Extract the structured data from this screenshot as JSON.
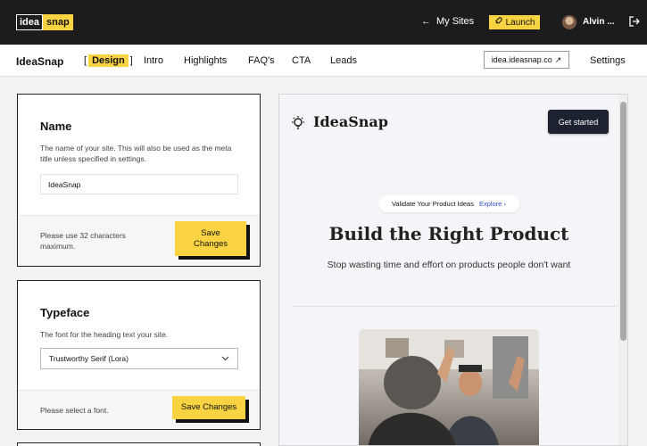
{
  "topbar": {
    "logo_part1": "idea",
    "logo_part2": "snap",
    "my_sites": "My Sites",
    "launch": "Launch",
    "user_name": "Alvin ..."
  },
  "subnav": {
    "brand": "IdeaSnap",
    "tabs": [
      {
        "label": "Design",
        "active": true
      },
      {
        "label": "Intro"
      },
      {
        "label": "Highlights"
      },
      {
        "label": "FAQ's"
      },
      {
        "label": "CTA"
      },
      {
        "label": "Leads"
      }
    ],
    "domain": "idea.ideasnap.co",
    "settings": "Settings"
  },
  "name_card": {
    "title": "Name",
    "description": "The name of your site. This will also be used as the meta title unless specified in settings.",
    "value": "IdeaSnap",
    "hint": "Please use 32 characters maximum.",
    "save_label": "Save Changes"
  },
  "typeface_card": {
    "title": "Typeface",
    "description": "The font for the heading text your site.",
    "selected": "Trustworthy Serif (Lora)",
    "hint": "Please select a font.",
    "save_label": "Save Changes"
  },
  "preview": {
    "brand": "IdeaSnap",
    "cta": "Get started",
    "pill_text": "Validate Your Product Ideas",
    "pill_link": "Explore",
    "headline": "Build the Right Product",
    "subheadline": "Stop wasting time and effort on products people don't want"
  },
  "colors": {
    "accent": "#f9d342",
    "topbar_bg": "#1c1c1c",
    "preview_button": "#1d2230",
    "link": "#2b4ed1"
  }
}
